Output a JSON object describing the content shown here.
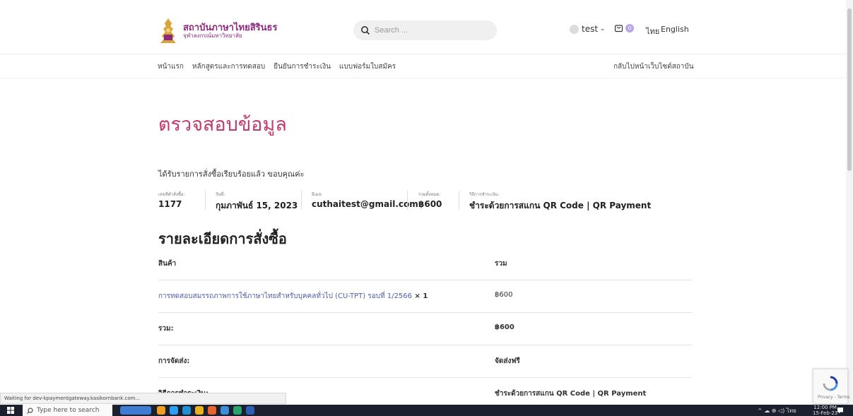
{
  "header": {
    "logo_title": "สถาบันภาษาไทยสิรินธร",
    "logo_subtitle": "จุฬาลงกรณ์มหาวิทยาลัย",
    "search_placeholder": "Search ...",
    "user_name": "test",
    "cart_count": "0",
    "lang_thai": "ไทย",
    "lang_english": "English"
  },
  "nav": {
    "items": [
      "หน้าแรก",
      "หลักสูตรและการทดสอบ",
      "ยืนยันการชำระเงิน",
      "แบบฟอร์มใบสมัคร"
    ],
    "right": "กลับไปหน้าเว็บไซต์สถาบัน"
  },
  "page": {
    "title": "ตรวจสอบข้อมูล",
    "thanks": "ได้รับรายการสั่งซื้อเรียบร้อยแล้ว ขอบคุณค่ะ"
  },
  "overview": [
    {
      "label": "เลขที่คำสั่งซื้อ:",
      "value": "1177"
    },
    {
      "label": "วันที่:",
      "value": "กุมภาพันธ์ 15, 2023"
    },
    {
      "label": "อีเมล:",
      "value": "cuthaitest@gmail.com"
    },
    {
      "label": "รวมทั้งหมด:",
      "value": "฿600"
    },
    {
      "label": "วิธีการชำระเงิน:",
      "value": "ชำระด้วยการสแกน QR Code | QR Payment"
    }
  ],
  "details": {
    "title": "รายละเอียดการสั่งซื้อ",
    "header": {
      "product": "สินค้า",
      "total": "รวม"
    },
    "item": {
      "name": "การทดสอบสมรรถภาพการใช้ภาษาไทยสำหรับบุคคลทั่วไป (CU-TPT) รอบที่ 1/2566",
      "qty": " × 1",
      "total": "฿600"
    },
    "subtotal": {
      "label": "รวม:",
      "value": "฿600"
    },
    "shipping": {
      "label": "การจัดส่ง:",
      "value": "จัดส่งฟรี"
    },
    "payment": {
      "label": "วิธีการชำระเงิน:",
      "value": "ชำระด้วยการสแกน QR Code | QR Payment"
    }
  },
  "browser": {
    "status_text": "Waiting for dev-kpaymentgateway.kasikornbank.com..."
  },
  "recaptcha": {
    "text": "Privacy - Terms"
  },
  "taskbar": {
    "search_placeholder": "Type here to search",
    "tray_lang": "ไทย",
    "time": "12:00 PM",
    "date": "15-Feb-23"
  },
  "colors": {
    "title": "#c23a6e",
    "brand": "#8c2a7e",
    "link": "#4f5fa8"
  }
}
